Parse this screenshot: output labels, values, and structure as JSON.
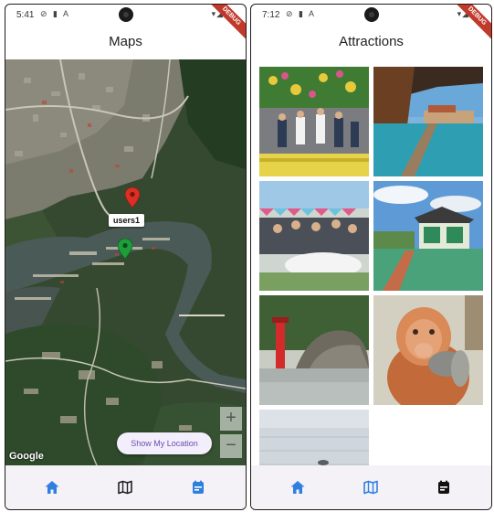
{
  "left_screen": {
    "status": {
      "time": "5:41",
      "icons": "⊘ ▮ A",
      "right": "▾◢▮",
      "debug": "DEBUG"
    },
    "title": "Maps",
    "map": {
      "marker_label": "users1",
      "attribution": "Google",
      "zoom_in": "+",
      "zoom_out": "−",
      "location_button": "Show My Location",
      "pin_colors": {
        "red": "#d93025",
        "green": "#1e9e3a"
      }
    },
    "nav": {
      "items": [
        {
          "name": "home",
          "icon": "home-icon",
          "active": true
        },
        {
          "name": "map",
          "icon": "map-icon",
          "active": false
        },
        {
          "name": "attractions",
          "icon": "attractions-icon",
          "active": false
        }
      ],
      "accent": "#2f7fe0"
    }
  },
  "right_screen": {
    "status": {
      "time": "7:12",
      "icons": "⊘ ▮ A",
      "right": "▾◢▮",
      "debug": "DEBUG"
    },
    "title": "Attractions",
    "gallery": [
      {
        "subject": "people-decorations-photo"
      },
      {
        "subject": "water-village-boardwalk-photo"
      },
      {
        "subject": "group-dining-photo"
      },
      {
        "subject": "stilt-house-photo"
      },
      {
        "subject": "lighthouse-rock-photo"
      },
      {
        "subject": "proboscis-monkey-photo"
      },
      {
        "subject": "sea-photo"
      }
    ],
    "nav": {
      "items": [
        {
          "name": "home",
          "icon": "home-icon"
        },
        {
          "name": "map",
          "icon": "map-icon"
        },
        {
          "name": "attractions",
          "icon": "attractions-icon"
        }
      ],
      "accent": "#2f7fe0"
    }
  }
}
